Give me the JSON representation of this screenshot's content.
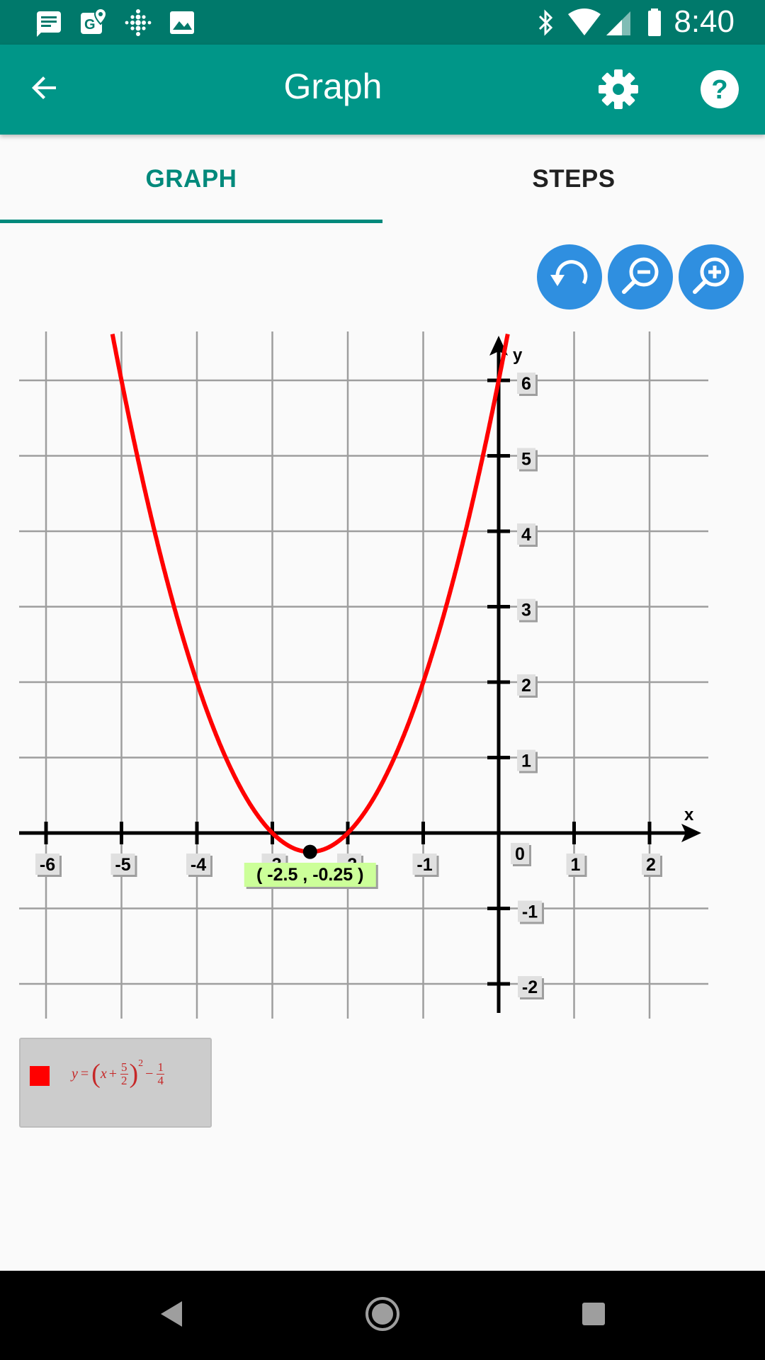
{
  "status_bar": {
    "time": "8:40",
    "left_icons": [
      "message-icon",
      "maps-icon",
      "fitbit-icon",
      "image-icon"
    ],
    "right_icons": [
      "bluetooth-icon",
      "wifi-icon",
      "signal-icon",
      "battery-icon"
    ]
  },
  "app_bar": {
    "title": "Graph",
    "back_icon": "arrow-back-icon",
    "settings_icon": "gear-icon",
    "help_icon": "help-icon"
  },
  "tabs": [
    {
      "label": "GRAPH",
      "active": true
    },
    {
      "label": "STEPS",
      "active": false
    }
  ],
  "controls": [
    "reset-icon",
    "zoom-out-icon",
    "zoom-in-icon"
  ],
  "colors": {
    "primary": "#009688",
    "primary_dark": "#00796b",
    "accent": "#00897b",
    "button_blue": "#2f8fe0",
    "curve": "#ff0000",
    "vertex_label_bg": "#ccff99"
  },
  "graph": {
    "x_axis_label": "x",
    "y_axis_label": "y",
    "x_ticks": [
      "-6",
      "-5",
      "-4",
      "-3",
      "-2",
      "-1",
      "0",
      "1",
      "2"
    ],
    "y_ticks": [
      "6",
      "5",
      "4",
      "3",
      "2",
      "1",
      "-1",
      "-2"
    ],
    "x_range": [
      -6.35,
      2.75
    ],
    "y_range": [
      -2.45,
      6.65
    ],
    "vertex": {
      "x": -2.5,
      "y": -0.25
    },
    "vertex_label": "( -2.5 , -0.25 )",
    "function": {
      "a": 1,
      "h": -2.5,
      "k": -0.25
    }
  },
  "legend": {
    "lhs": "y",
    "eq": "=",
    "var": "x",
    "plus": "+",
    "frac1_num": "5",
    "frac1_den": "2",
    "exponent": "2",
    "minus": "−",
    "frac2_num": "1",
    "frac2_den": "4"
  },
  "nav_bar": {
    "buttons": [
      "nav-back-icon",
      "nav-home-icon",
      "nav-recents-icon"
    ]
  }
}
